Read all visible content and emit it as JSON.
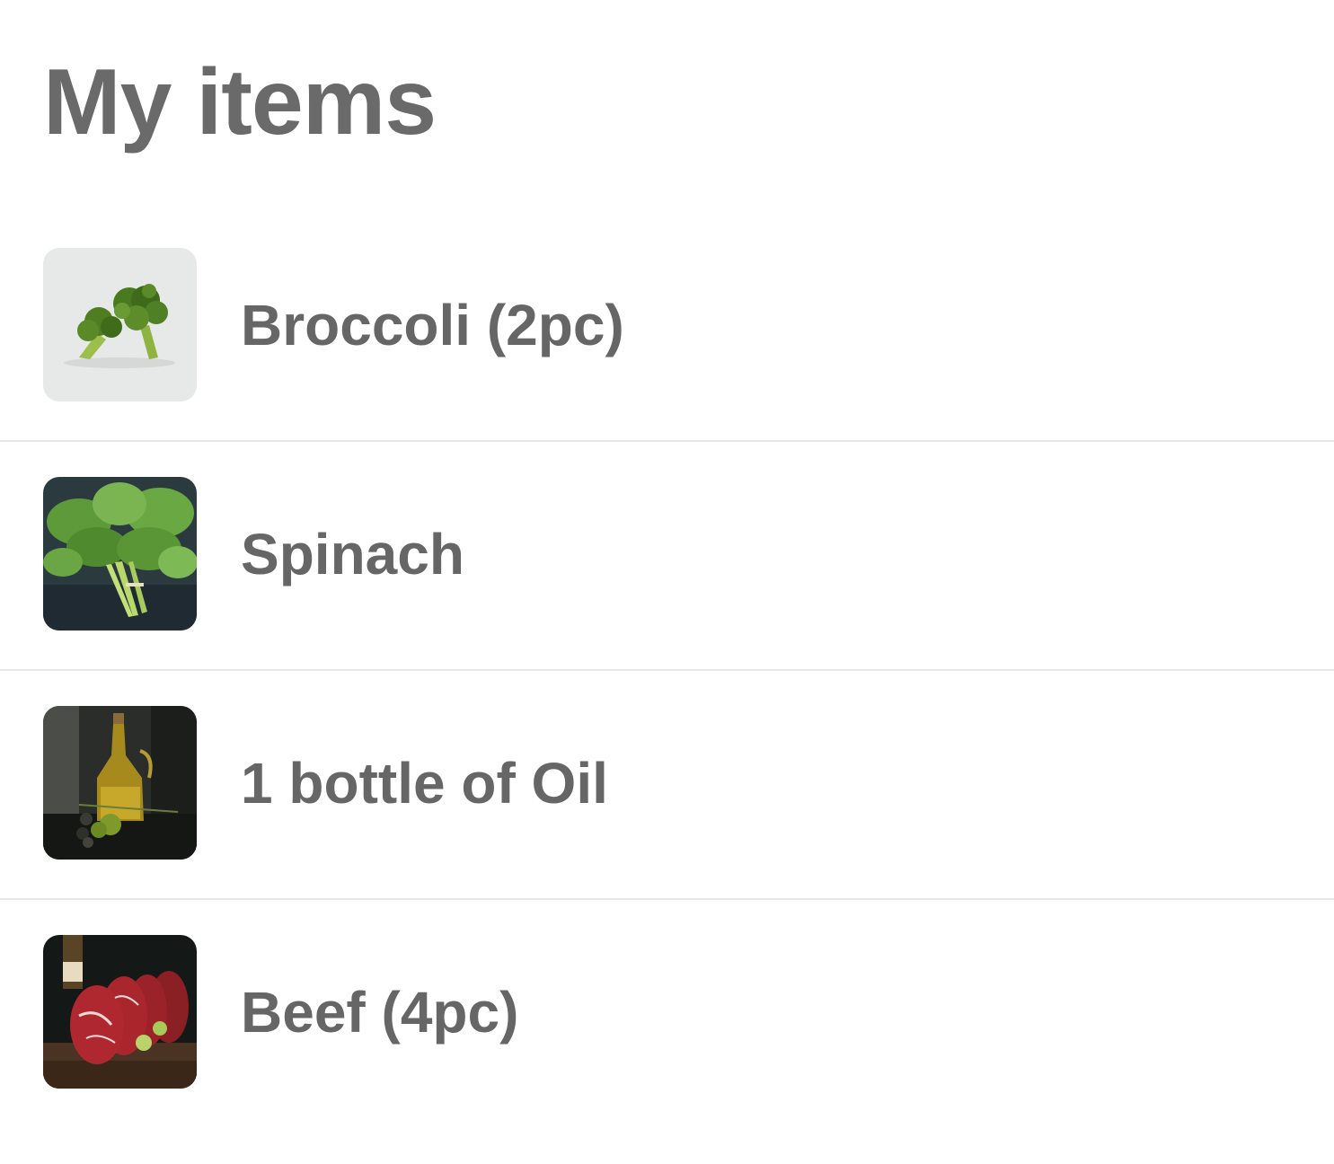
{
  "page": {
    "title": "My items"
  },
  "items": [
    {
      "label": "Broccoli (2pc)",
      "image": "broccoli-image"
    },
    {
      "label": "Spinach",
      "image": "spinach-image"
    },
    {
      "label": "1 bottle of Oil",
      "image": "oil-bottle-image"
    },
    {
      "label": "Beef (4pc)",
      "image": "beef-image"
    }
  ],
  "colors": {
    "text": "#666666",
    "divider": "#e6e6e6",
    "background": "#ffffff"
  }
}
